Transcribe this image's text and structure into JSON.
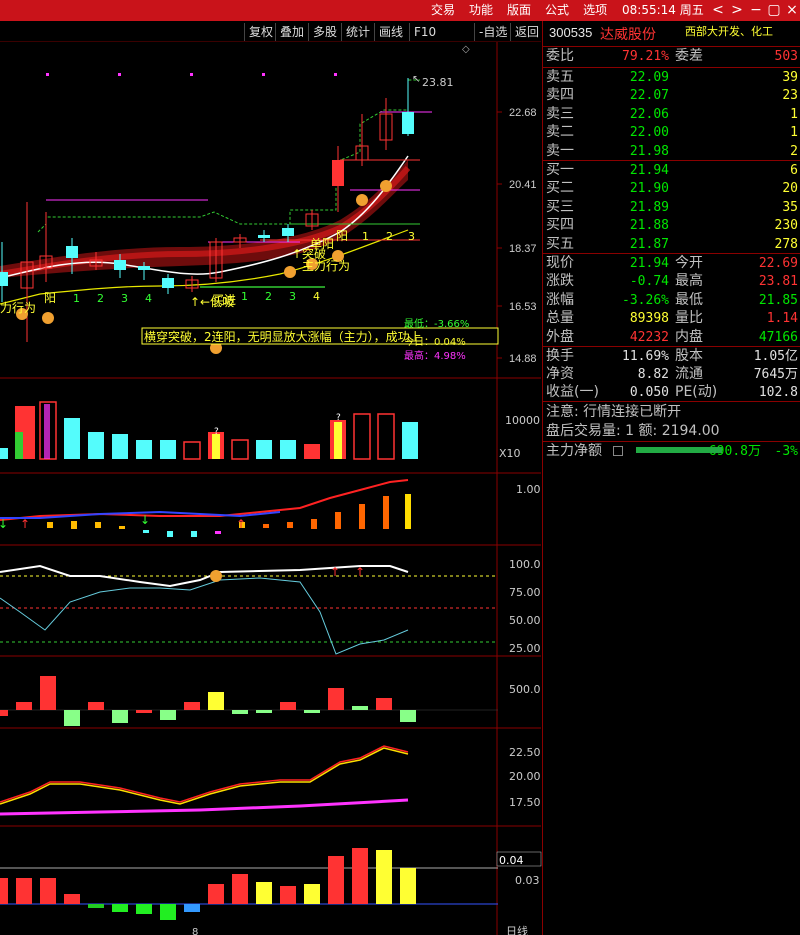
{
  "topbar": {
    "menu": [
      "交易",
      "功能",
      "版面",
      "公式",
      "选项"
    ],
    "clock": "08:55:14 周五",
    "buttons": [
      "<",
      ">",
      "−",
      "▢",
      "×"
    ]
  },
  "toolbar": [
    "复权",
    "叠加",
    "多股",
    "统计",
    "画线",
    "F10",
    "-自选",
    "返回"
  ],
  "chart": {
    "price_ticks": [
      "22.68",
      "20.41",
      "18.37",
      "16.53",
      "14.88"
    ],
    "high_label": "23.81",
    "volume_tick": "10000",
    "volume_unit": "X10",
    "ind1_tick": "1.00",
    "ind2_ticks": [
      "100.0",
      "75.00",
      "50.00",
      "25.00"
    ],
    "ind3_tick": "500.0",
    "ind4_ticks": [
      "22.50",
      "20.00",
      "17.50"
    ],
    "ind5_ticks": [
      "0.04",
      "0.03"
    ],
    "x_label": "8",
    "date_button": "日线",
    "annotations": {
      "bar_label": "横穿突破，2连阳，无明显放大涨幅（主力），成功上",
      "stats": [
        "最低：-3.66%",
        "今日：0.04%",
        "最高：4.98%"
      ],
      "left_text": "力行为",
      "yang": "阳",
      "counts_left": [
        "1",
        "2",
        "3",
        "4"
      ],
      "bsp_text": "↑←低吸",
      "buy_text": "买进",
      "counts_mid": [
        "1",
        "2",
        "3",
        "4"
      ],
      "tupo": "↑突破",
      "danyang": "单阳",
      "yang2": "阳",
      "zhuli": "主力行为",
      "counts_right": [
        "1",
        "2",
        "3"
      ],
      "q_mark": "?"
    }
  },
  "quote": {
    "code": "300535",
    "name": "达威股份",
    "industry": "西部大开发、化工",
    "weibi_label": "委比",
    "weibi_value": "79.21%",
    "weicha_label": "委差",
    "weicha_value": "503",
    "asks": [
      {
        "label": "卖五",
        "price": "22.09",
        "vol": "39"
      },
      {
        "label": "卖四",
        "price": "22.07",
        "vol": "23"
      },
      {
        "label": "卖三",
        "price": "22.06",
        "vol": "1"
      },
      {
        "label": "卖二",
        "price": "22.00",
        "vol": "1"
      },
      {
        "label": "卖一",
        "price": "21.98",
        "vol": "2"
      }
    ],
    "bids": [
      {
        "label": "买一",
        "price": "21.94",
        "vol": "6"
      },
      {
        "label": "买二",
        "price": "21.90",
        "vol": "20"
      },
      {
        "label": "买三",
        "price": "21.89",
        "vol": "35"
      },
      {
        "label": "买四",
        "price": "21.88",
        "vol": "230"
      },
      {
        "label": "买五",
        "price": "21.87",
        "vol": "278"
      }
    ],
    "stats": [
      {
        "l1": "现价",
        "v1": "21.94",
        "c1": "green",
        "l2": "今开",
        "v2": "22.69",
        "c2": "red"
      },
      {
        "l1": "涨跌",
        "v1": "-0.74",
        "c1": "green",
        "l2": "最高",
        "v2": "23.81",
        "c2": "red"
      },
      {
        "l1": "涨幅",
        "v1": "-3.26%",
        "c1": "green",
        "l2": "最低",
        "v2": "21.85",
        "c2": "green"
      },
      {
        "l1": "总量",
        "v1": "89398",
        "c1": "yellow",
        "l2": "量比",
        "v2": "1.14",
        "c2": "red"
      },
      {
        "l1": "外盘",
        "v1": "42232",
        "c1": "red",
        "l2": "内盘",
        "v2": "47166",
        "c2": "green"
      }
    ],
    "stats2": [
      {
        "l1": "换手",
        "v1": "11.69%",
        "c1": "white",
        "l2": "股本",
        "v2": "1.05亿",
        "c2": "white"
      },
      {
        "l1": "净资",
        "v1": "8.82",
        "c1": "white",
        "l2": "流通",
        "v2": "7645万",
        "c2": "white"
      },
      {
        "l1": "收益(一)",
        "v1": "0.050",
        "c1": "white",
        "l2": "PE(动)",
        "v2": "102.8",
        "c2": "white"
      }
    ],
    "notice": "注意: 行情连接已断开",
    "after_hours": "盘后交易量: 1  额: 2194.00",
    "main_net_label": "主力净额",
    "main_net_value": "-690.8万",
    "main_net_pct": "-3%"
  },
  "colors": {
    "up": "#ff3333",
    "down": "#00e600",
    "cyan": "#54fcfc",
    "yellow": "#ffff33",
    "magenta": "#ff33ff",
    "frame": "#8a0000"
  }
}
